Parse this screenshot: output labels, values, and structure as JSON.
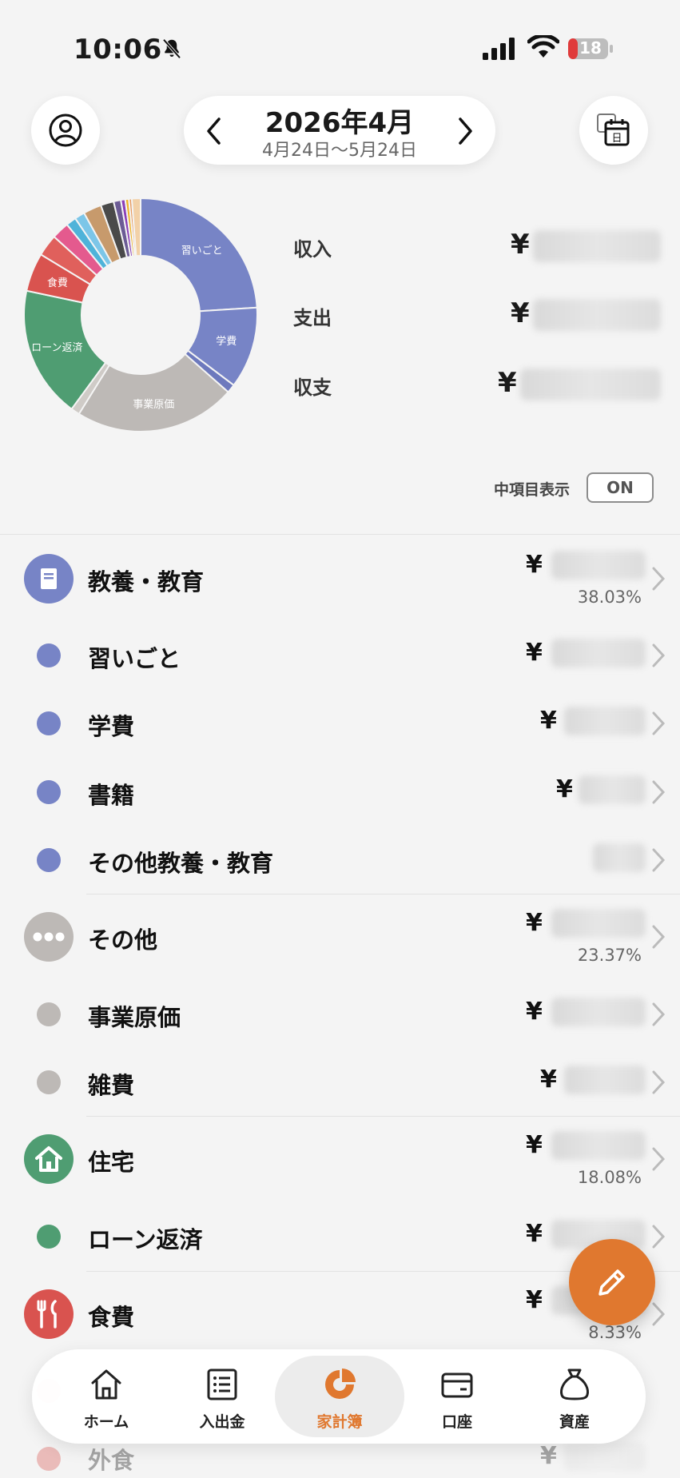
{
  "status_bar": {
    "time": "10:06",
    "battery": "18"
  },
  "header": {
    "title": "2026年4月",
    "range": "4月24日〜5月24日"
  },
  "colors": {
    "accent": "#e0782f",
    "education": "#7784c6",
    "other": "#bdb9b6",
    "housing": "#4f9d72",
    "food": "#d9534f"
  },
  "chart_data": {
    "type": "pie",
    "labels_shown": [
      "習いごと",
      "学費",
      "事業原価",
      "ローン返済",
      "食費"
    ],
    "slices": [
      {
        "label": "習いごと",
        "value": 0.238,
        "color": "#7784c6"
      },
      {
        "label": "学費",
        "value": 0.112,
        "color": "#7784c6"
      },
      {
        "label": "",
        "value": 0.012,
        "color": "#6d79bd"
      },
      {
        "label": "事業原価",
        "value": 0.222,
        "color": "#bdb9b6"
      },
      {
        "label": "",
        "value": 0.012,
        "color": "#cfcbc7"
      },
      {
        "label": "ローン返済",
        "value": 0.181,
        "color": "#4f9d72"
      },
      {
        "label": "食費",
        "value": 0.053,
        "color": "#d9534f"
      },
      {
        "label": "",
        "value": 0.03,
        "color": "#e0605c"
      },
      {
        "label": "",
        "value": 0.024,
        "color": "#e45a8e"
      },
      {
        "label": "",
        "value": 0.014,
        "color": "#4fb3d9"
      },
      {
        "label": "",
        "value": 0.014,
        "color": "#7cc6e8"
      },
      {
        "label": "",
        "value": 0.025,
        "color": "#c79a6c"
      },
      {
        "label": "",
        "value": 0.018,
        "color": "#4a4a4a"
      },
      {
        "label": "",
        "value": 0.01,
        "color": "#6b5b95"
      },
      {
        "label": "",
        "value": 0.006,
        "color": "#8a3fb8"
      },
      {
        "label": "",
        "value": 0.005,
        "color": "#f0b429"
      },
      {
        "label": "",
        "value": 0.004,
        "color": "#e89b5f"
      },
      {
        "label": "",
        "value": 0.012,
        "color": "#f2d1a8"
      }
    ]
  },
  "summary": {
    "income_label": "収入",
    "expense_label": "支出",
    "balance_label": "収支",
    "yen": "¥"
  },
  "toggle": {
    "label": "中項目表示",
    "value": "ON"
  },
  "categories": {
    "education": {
      "label": "教養・教育",
      "yen": "¥",
      "pct": "38.03%"
    },
    "lessons": {
      "label": "習いごと",
      "yen": "¥"
    },
    "tuition": {
      "label": "学費",
      "yen": "¥"
    },
    "books": {
      "label": "書籍",
      "yen": "¥"
    },
    "other_edu": {
      "label": "その他教養・教育"
    },
    "other": {
      "label": "その他",
      "yen": "¥",
      "pct": "23.37%"
    },
    "business_cost": {
      "label": "事業原価",
      "yen": "¥"
    },
    "misc": {
      "label": "雑費",
      "yen": "¥"
    },
    "housing": {
      "label": "住宅",
      "yen": "¥",
      "pct": "18.08%"
    },
    "loan": {
      "label": "ローン返済",
      "yen": "¥"
    },
    "food": {
      "label": "食費",
      "yen": "¥",
      "pct": "8.33%"
    },
    "eating_out": {
      "label": "外食",
      "yen": "¥"
    }
  },
  "tabs": [
    {
      "label": "ホーム",
      "icon": "home-icon"
    },
    {
      "label": "入出金",
      "icon": "list-icon"
    },
    {
      "label": "家計簿",
      "icon": "pie-chart-icon"
    },
    {
      "label": "口座",
      "icon": "wallet-icon"
    },
    {
      "label": "資産",
      "icon": "money-bag-icon"
    }
  ]
}
